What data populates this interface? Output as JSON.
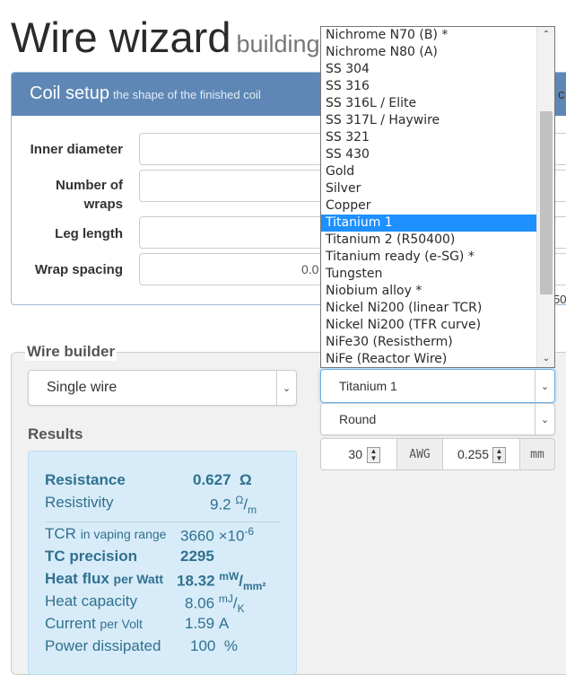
{
  "header": {
    "title": "Wire wizard",
    "subtitle": "building"
  },
  "coil_setup": {
    "title": "Coil setup",
    "subtitle": "the shape of the finished coil",
    "fields": [
      {
        "label": "Inner diameter",
        "value": ""
      },
      {
        "label": "Number of wraps",
        "value": ""
      },
      {
        "label": "Leg length",
        "value": ""
      },
      {
        "label": "Wrap spacing",
        "value": "0.0"
      }
    ]
  },
  "edge_fragments": {
    "top_right": "c",
    "mid_right": "50"
  },
  "wire_builder": {
    "legend": "Wire builder",
    "wire_type": "Single wire",
    "material": "Titanium 1",
    "profile": "Round",
    "gauge": "30",
    "gauge_unit": "AWG",
    "diameter": "0.255",
    "diameter_unit": "mm"
  },
  "material_dropdown": {
    "selected_index": 11,
    "options": [
      "Nichrome N70 (B) *",
      "Nichrome N80 (A)",
      "SS 304",
      "SS 316",
      "SS 316L / Elite",
      "SS 317L / Haywire",
      "SS 321",
      "SS 430",
      "Gold",
      "Silver",
      "Copper",
      "Titanium 1",
      "Titanium 2 (R50400)",
      "Titanium ready (e-SG) *",
      "Tungsten",
      "Niobium alloy *",
      "Nickel Ni200 (linear TCR)",
      "Nickel Ni200 (TFR curve)",
      "NiFe30 (Resistherm)",
      "NiFe (Reactor Wire)"
    ]
  },
  "results": {
    "label": "Results",
    "resistance": {
      "label": "Resistance",
      "value": "0.627",
      "unit": "Ω"
    },
    "resistivity": {
      "label": "Resistivity",
      "value": "9.2",
      "unit_num": "Ω",
      "unit_den": "m"
    },
    "tcr": {
      "label": "TCR",
      "qualifier": "in vaping range",
      "value": "3660",
      "unit": "×10",
      "exp": "-6"
    },
    "tc_precision": {
      "label": "TC precision",
      "value": "2295"
    },
    "heat_flux": {
      "label": "Heat flux",
      "qualifier": "per Watt",
      "value": "18.32",
      "unit_num": "mW",
      "unit_den": "mm²"
    },
    "heat_capacity": {
      "label": "Heat capacity",
      "value": "8.06",
      "unit_num": "mJ",
      "unit_den": "K"
    },
    "current": {
      "label": "Current",
      "qualifier": "per Volt",
      "value": "1.59",
      "unit": "A"
    },
    "power": {
      "label": "Power dissipated",
      "value": "100",
      "unit": "%"
    }
  }
}
